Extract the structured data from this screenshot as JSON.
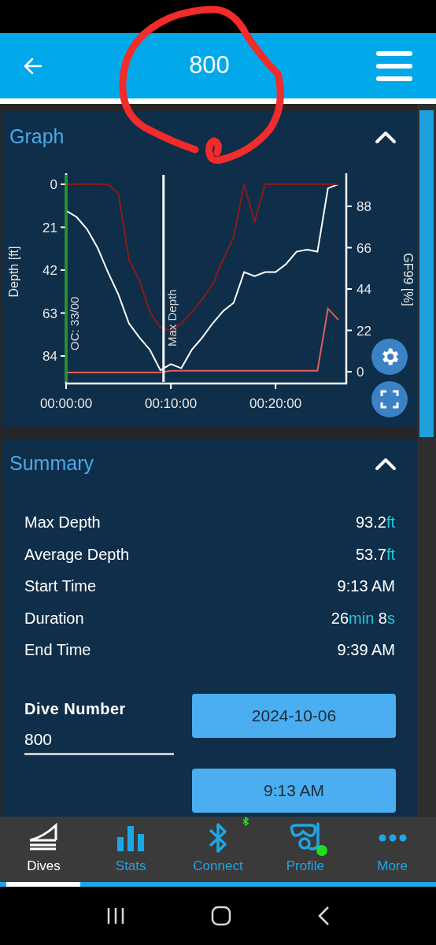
{
  "header": {
    "title": "800"
  },
  "graph": {
    "title": "Graph",
    "expanded": true,
    "chart_data": {
      "type": "line",
      "ylabel": "Depth [ft]",
      "y2label": "GF99 [%]",
      "x": [
        0,
        1,
        2,
        3,
        4,
        5,
        6,
        7,
        8,
        9,
        10,
        11,
        12,
        13,
        14,
        15,
        16,
        17,
        18,
        19,
        20,
        21,
        22,
        23,
        24,
        25,
        26
      ],
      "xlim": [
        0,
        26.6
      ],
      "ylim": [
        96.7,
        -4.6
      ],
      "y2lim": [
        -5,
        105
      ],
      "xticks": [
        {
          "value": 0,
          "label": "00:00:00"
        },
        {
          "value": 10,
          "label": "00:10:00"
        },
        {
          "value": 20,
          "label": "00:20:00"
        }
      ],
      "yticks": [
        0,
        21,
        42,
        63,
        84
      ],
      "y2ticks": [
        0,
        22,
        44,
        66,
        88
      ],
      "series": [
        {
          "color": "#ffffff",
          "values": [
            13,
            16,
            22,
            31,
            43,
            54,
            68,
            75,
            81,
            91,
            88,
            90,
            81,
            75,
            68,
            62,
            58,
            43,
            45,
            43,
            43,
            39,
            33,
            32,
            33,
            2,
            0
          ]
        },
        {
          "color": "#8b1a1a",
          "axis": "y2",
          "values": [
            100,
            100,
            100,
            100,
            100,
            95,
            60,
            49,
            32,
            24,
            22,
            26,
            32,
            39,
            47,
            60,
            72,
            100,
            80,
            100,
            100,
            100,
            100,
            100,
            100,
            100,
            100
          ]
        },
        {
          "color": "#e0605a",
          "axis": "y2",
          "values": [
            0,
            0,
            0,
            0,
            0,
            0,
            0,
            0,
            0,
            0,
            1,
            1,
            1,
            1,
            1,
            1,
            1,
            1,
            1,
            1,
            1,
            1,
            1,
            1,
            1,
            34,
            28
          ]
        }
      ],
      "ref_lines": [
        {
          "axis": "x",
          "value": 0,
          "label": "OC: 33/00",
          "color": "#1f9a1f"
        },
        {
          "axis": "x",
          "value": 9.3,
          "label": "Max Depth",
          "color": "#ffffff"
        }
      ]
    }
  },
  "summary": {
    "title": "Summary",
    "expanded": true,
    "rows": [
      {
        "label": "Max Depth",
        "value": [
          {
            "text": "93.2",
            "kind": "number"
          },
          {
            "text": "ft",
            "kind": "unit"
          }
        ]
      },
      {
        "label": "Average Depth",
        "value": [
          {
            "text": "53.7",
            "kind": "number"
          },
          {
            "text": "ft",
            "kind": "unit"
          }
        ]
      },
      {
        "label": "Start Time",
        "value": [
          {
            "text": "9:13 AM",
            "kind": "number"
          }
        ]
      },
      {
        "label": "Duration",
        "value": [
          {
            "text": "26",
            "kind": "number"
          },
          {
            "text": "min",
            "kind": "unit"
          },
          {
            "text": " 8",
            "kind": "number"
          },
          {
            "text": "s",
            "kind": "unit"
          }
        ]
      },
      {
        "label": "End Time",
        "value": [
          {
            "text": "9:39 AM",
            "kind": "number"
          }
        ]
      }
    ],
    "dive_number": {
      "label": "Dive Number",
      "value": "800"
    },
    "buttons": [
      "2024-10-06",
      "9:13 AM"
    ]
  },
  "nav": [
    {
      "label": "Dives",
      "kind": "dives",
      "selected": true,
      "badge": false
    },
    {
      "label": "Stats",
      "kind": "stats",
      "selected": false,
      "badge": false
    },
    {
      "label": "Connect",
      "kind": "bluetooth",
      "selected": false,
      "badge": true
    },
    {
      "label": "Profile",
      "kind": "snorkel",
      "selected": false,
      "badge": true
    },
    {
      "label": "More",
      "kind": "more",
      "selected": false,
      "badge": false
    }
  ]
}
